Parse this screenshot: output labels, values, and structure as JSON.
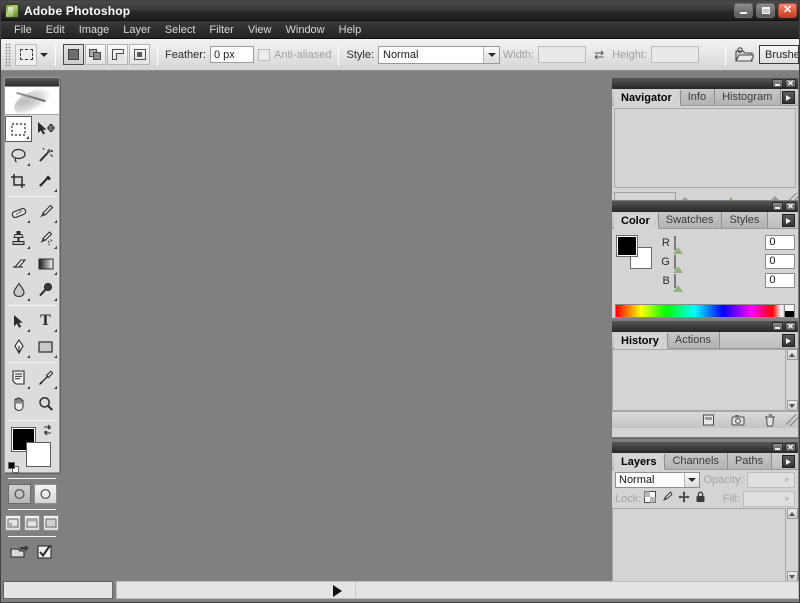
{
  "window": {
    "title": "Adobe Photoshop",
    "app_icon": "photoshop-feather-icon",
    "minimize_label": "Minimize",
    "maximize_label": "Maximize",
    "close_label": "Close"
  },
  "menubar": {
    "items": [
      {
        "label": "File"
      },
      {
        "label": "Edit"
      },
      {
        "label": "Image"
      },
      {
        "label": "Layer"
      },
      {
        "label": "Select"
      },
      {
        "label": "Filter"
      },
      {
        "label": "View"
      },
      {
        "label": "Window"
      },
      {
        "label": "Help"
      }
    ]
  },
  "options_bar": {
    "tool_preset_icon": "rectangular-marquee-icon",
    "tool_preset_caret": "chevron-down-icon",
    "selection_modes": [
      {
        "name": "new-selection",
        "active": true
      },
      {
        "name": "add-to-selection",
        "active": false
      },
      {
        "name": "subtract-from-selection",
        "active": false
      },
      {
        "name": "intersect-with-selection",
        "active": false
      }
    ],
    "feather_label": "Feather:",
    "feather_value": "0 px",
    "antialiased_label": "Anti-aliased",
    "antialiased_checked": false,
    "style_label": "Style:",
    "style_value": "Normal",
    "width_label": "Width:",
    "width_value": "",
    "swap_icon": "swap-width-height-icon",
    "height_label": "Height:",
    "height_value": "",
    "file_browser_icon": "file-browser-icon",
    "palette_well_tab": "Brushes"
  },
  "toolbox": {
    "logo_icon": "photoshop-feather-logo",
    "tools": [
      {
        "name": "rectangular-marquee-tool",
        "label": "Rectangular Marquee Tool",
        "selected": true,
        "has_flyout": true
      },
      {
        "name": "move-tool",
        "label": "Move Tool",
        "selected": false,
        "has_flyout": false
      },
      {
        "name": "lasso-tool",
        "label": "Lasso Tool",
        "selected": false,
        "has_flyout": true
      },
      {
        "name": "magic-wand-tool",
        "label": "Magic Wand Tool",
        "selected": false,
        "has_flyout": false
      },
      {
        "name": "crop-tool",
        "label": "Crop Tool",
        "selected": false,
        "has_flyout": false
      },
      {
        "name": "slice-tool",
        "label": "Slice Tool",
        "selected": false,
        "has_flyout": true
      },
      {
        "name": "healing-brush-tool",
        "label": "Healing Brush Tool",
        "selected": false,
        "has_flyout": true
      },
      {
        "name": "brush-tool",
        "label": "Brush Tool",
        "selected": false,
        "has_flyout": true
      },
      {
        "name": "clone-stamp-tool",
        "label": "Clone Stamp Tool",
        "selected": false,
        "has_flyout": true
      },
      {
        "name": "history-brush-tool",
        "label": "History Brush Tool",
        "selected": false,
        "has_flyout": true
      },
      {
        "name": "eraser-tool",
        "label": "Eraser Tool",
        "selected": false,
        "has_flyout": true
      },
      {
        "name": "gradient-tool",
        "label": "Gradient Tool",
        "selected": false,
        "has_flyout": true
      },
      {
        "name": "blur-tool",
        "label": "Blur Tool",
        "selected": false,
        "has_flyout": true
      },
      {
        "name": "dodge-tool",
        "label": "Dodge Tool",
        "selected": false,
        "has_flyout": true
      },
      {
        "name": "path-selection-tool",
        "label": "Path Selection Tool",
        "selected": false,
        "has_flyout": true
      },
      {
        "name": "type-tool",
        "label": "Horizontal Type Tool",
        "selected": false,
        "has_flyout": true
      },
      {
        "name": "pen-tool",
        "label": "Pen Tool",
        "selected": false,
        "has_flyout": true
      },
      {
        "name": "rectangle-shape-tool",
        "label": "Rectangle Tool",
        "selected": false,
        "has_flyout": true
      },
      {
        "name": "notes-tool",
        "label": "Notes Tool",
        "selected": false,
        "has_flyout": true
      },
      {
        "name": "eyedropper-tool",
        "label": "Eyedropper Tool",
        "selected": false,
        "has_flyout": true
      },
      {
        "name": "hand-tool",
        "label": "Hand Tool",
        "selected": false,
        "has_flyout": false
      },
      {
        "name": "zoom-tool",
        "label": "Zoom Tool",
        "selected": false,
        "has_flyout": false
      }
    ],
    "foreground_color": "#000000",
    "background_color": "#ffffff",
    "swap_colors_icon": "swap-colors-icon",
    "default_colors_icon": "default-colors-icon",
    "mask_modes": [
      {
        "name": "standard-mode-button",
        "active": true
      },
      {
        "name": "quick-mask-mode-button",
        "active": false
      }
    ],
    "screen_modes": [
      {
        "name": "standard-screen-mode-button",
        "active": true
      },
      {
        "name": "full-screen-with-menubar-button",
        "active": false
      },
      {
        "name": "full-screen-mode-button",
        "active": false
      }
    ],
    "jump_to_icon": "jump-to-imageready-icon",
    "jump_to_check_icon": "jump-to-check-icon"
  },
  "palettes": {
    "navigator": {
      "tabs": [
        {
          "label": "Navigator",
          "active": true
        },
        {
          "label": "Info",
          "active": false
        },
        {
          "label": "Histogram",
          "active": false
        }
      ],
      "menu_icon": "palette-menu-icon",
      "zoom_value": "",
      "zoom_out_icon": "zoom-out-icon",
      "zoom_in_icon": "zoom-in-icon",
      "slider_thumb": "zoom-slider-thumb"
    },
    "color": {
      "tabs": [
        {
          "label": "Color",
          "active": true
        },
        {
          "label": "Swatches",
          "active": false
        },
        {
          "label": "Styles",
          "active": false
        }
      ],
      "menu_icon": "palette-menu-icon",
      "foreground_color": "#000000",
      "background_color": "#ffffff",
      "channels": [
        {
          "label": "R",
          "value": "0",
          "color": "#ff0000"
        },
        {
          "label": "G",
          "value": "0",
          "color": "#00ff00"
        },
        {
          "label": "B",
          "value": "0",
          "color": "#0000ff"
        }
      ],
      "spectrum_name": "color-ramp"
    },
    "history": {
      "tabs": [
        {
          "label": "History",
          "active": true
        },
        {
          "label": "Actions",
          "active": false
        }
      ],
      "menu_icon": "palette-menu-icon",
      "footer_buttons": [
        {
          "name": "create-document-from-state-button"
        },
        {
          "name": "create-new-snapshot-button"
        },
        {
          "name": "delete-state-button"
        }
      ]
    },
    "layers": {
      "tabs": [
        {
          "label": "Layers",
          "active": true
        },
        {
          "label": "Channels",
          "active": false
        },
        {
          "label": "Paths",
          "active": false
        }
      ],
      "menu_icon": "palette-menu-icon",
      "blend_mode": "Normal",
      "opacity_label": "Opacity:",
      "opacity_value": "",
      "lock_label": "Lock:",
      "lock_buttons": [
        {
          "name": "lock-transparent-pixels-button"
        },
        {
          "name": "lock-image-pixels-button"
        },
        {
          "name": "lock-position-button"
        },
        {
          "name": "lock-all-button"
        }
      ],
      "fill_label": "Fill:",
      "fill_value": "",
      "footer_buttons": [
        {
          "name": "layer-style-button"
        },
        {
          "name": "add-layer-mask-button"
        },
        {
          "name": "new-group-button"
        },
        {
          "name": "new-adjustment-layer-button"
        },
        {
          "name": "new-layer-button"
        },
        {
          "name": "delete-layer-button"
        }
      ]
    }
  },
  "status_bar": {
    "zoom_value": "",
    "info_text": "",
    "popup_arrow_icon": "status-popup-arrow-icon"
  },
  "colors": {
    "canvas_gray": "#808080",
    "palette_gray": "#d4d4d4",
    "titlebar_dark": "#2a2a2a",
    "close_red": "#cc3a1e",
    "accent_green": "#7ea76a"
  }
}
